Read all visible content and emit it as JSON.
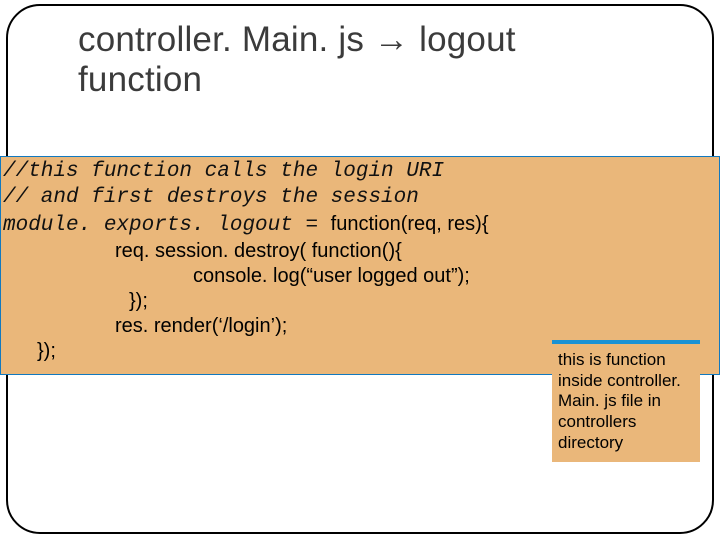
{
  "title": "controller. Main. js → logout function",
  "code": {
    "c1": "//this function calls the login URI",
    "c2": "// and first destroys the session",
    "m1a": "module. exports. logout = ",
    "m1b": "function(req, res){",
    "l2": "req. session. destroy( function(){",
    "l3": "console. log(“user logged out”);",
    "l4": "});",
    "l5": "res. render(‘/login’);",
    "l6": "});"
  },
  "callout": "this is function inside controller. Main. js  file in controllers directory"
}
